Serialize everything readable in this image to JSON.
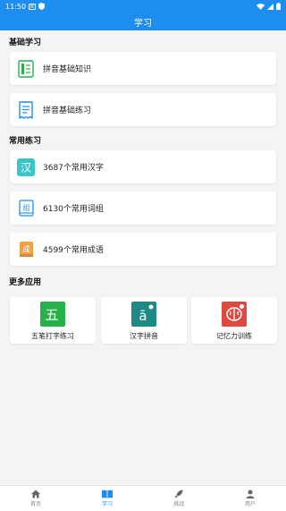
{
  "status": {
    "time": "11:50",
    "badge": "IK"
  },
  "header": {
    "title": "学习"
  },
  "sections": {
    "basic": {
      "title": "基础学习",
      "items": [
        {
          "label": "拼音基础知识"
        },
        {
          "label": "拼音基础练习"
        }
      ]
    },
    "common": {
      "title": "常用练习",
      "items": [
        {
          "label": "3687个常用汉字",
          "glyph": "汉"
        },
        {
          "label": "6130个常用词组",
          "glyph": "组"
        },
        {
          "label": "4599个常用成语",
          "glyph": "成"
        }
      ]
    },
    "more": {
      "title": "更多应用",
      "items": [
        {
          "label": "五笔打字练习",
          "glyph": "五"
        },
        {
          "label": "汉字拼音",
          "glyph": "ā"
        },
        {
          "label": "记忆力训练"
        }
      ]
    }
  },
  "tabbar": {
    "items": [
      {
        "label": "首页"
      },
      {
        "label": "学习"
      },
      {
        "label": "挑战"
      },
      {
        "label": "用户"
      }
    ]
  },
  "colors": {
    "primary": "#1d8ef0",
    "green": "#26b14a",
    "teal": "#1e8a86",
    "red": "#df4a40",
    "cyan": "#3bc5c8",
    "orange": "#f0a24b"
  }
}
